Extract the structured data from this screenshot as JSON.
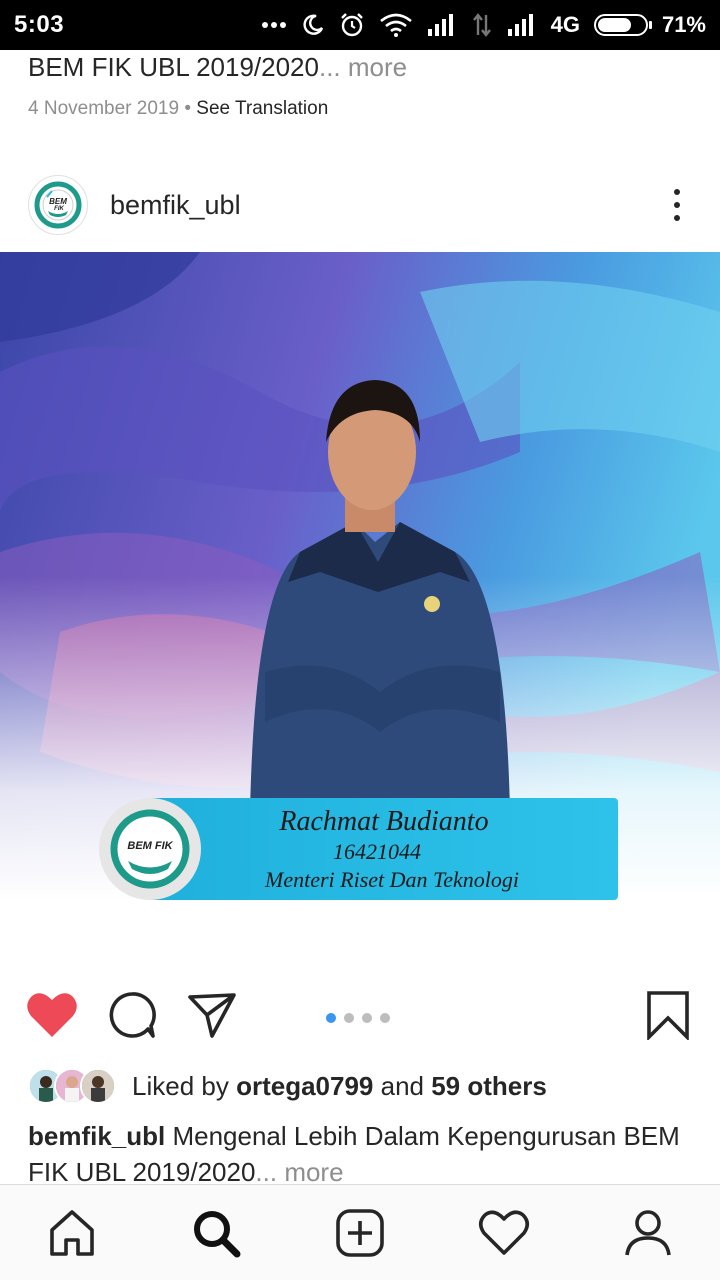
{
  "status_bar": {
    "time": "5:03",
    "network": "4G",
    "battery": "71%",
    "battery_level": 0.71,
    "icons": [
      "more-dots-icon",
      "moon-icon",
      "alarm-icon",
      "wifi-icon",
      "signal-icon",
      "data-arrows-icon",
      "signal-icon-2",
      "battery-icon"
    ]
  },
  "previous_post": {
    "caption": "BEM FIK UBL 2019/2020",
    "more": "... more",
    "date": "4 November 2019",
    "separator": " • ",
    "see_translation": "See Translation"
  },
  "post": {
    "username": "bemfik_ubl",
    "avatar_icon": "bem-fik-logo",
    "image": {
      "name_text": "Rachmat Budianto",
      "id_text": "16421044",
      "role_text": "Menteri Riset Dan Teknologi",
      "logo_text": "BEM FIK"
    },
    "pager": {
      "count": 4,
      "active": 0
    },
    "likes": {
      "prefix": "Liked by ",
      "user": "ortega0799",
      "middle": " and ",
      "others": "59 others"
    },
    "caption": {
      "user": "bemfik_ubl",
      "text": " Mengenal Lebih Dalam Kepengurusan BEM FIK UBL 2019/2020",
      "more": "... more"
    }
  },
  "colors": {
    "like_red": "#ed4956",
    "pager_blue": "#3897f0",
    "banner_blue": "#29b8e0"
  },
  "bottom_nav": [
    "home-icon",
    "search-icon",
    "add-post-icon",
    "activity-heart-icon",
    "profile-icon"
  ]
}
